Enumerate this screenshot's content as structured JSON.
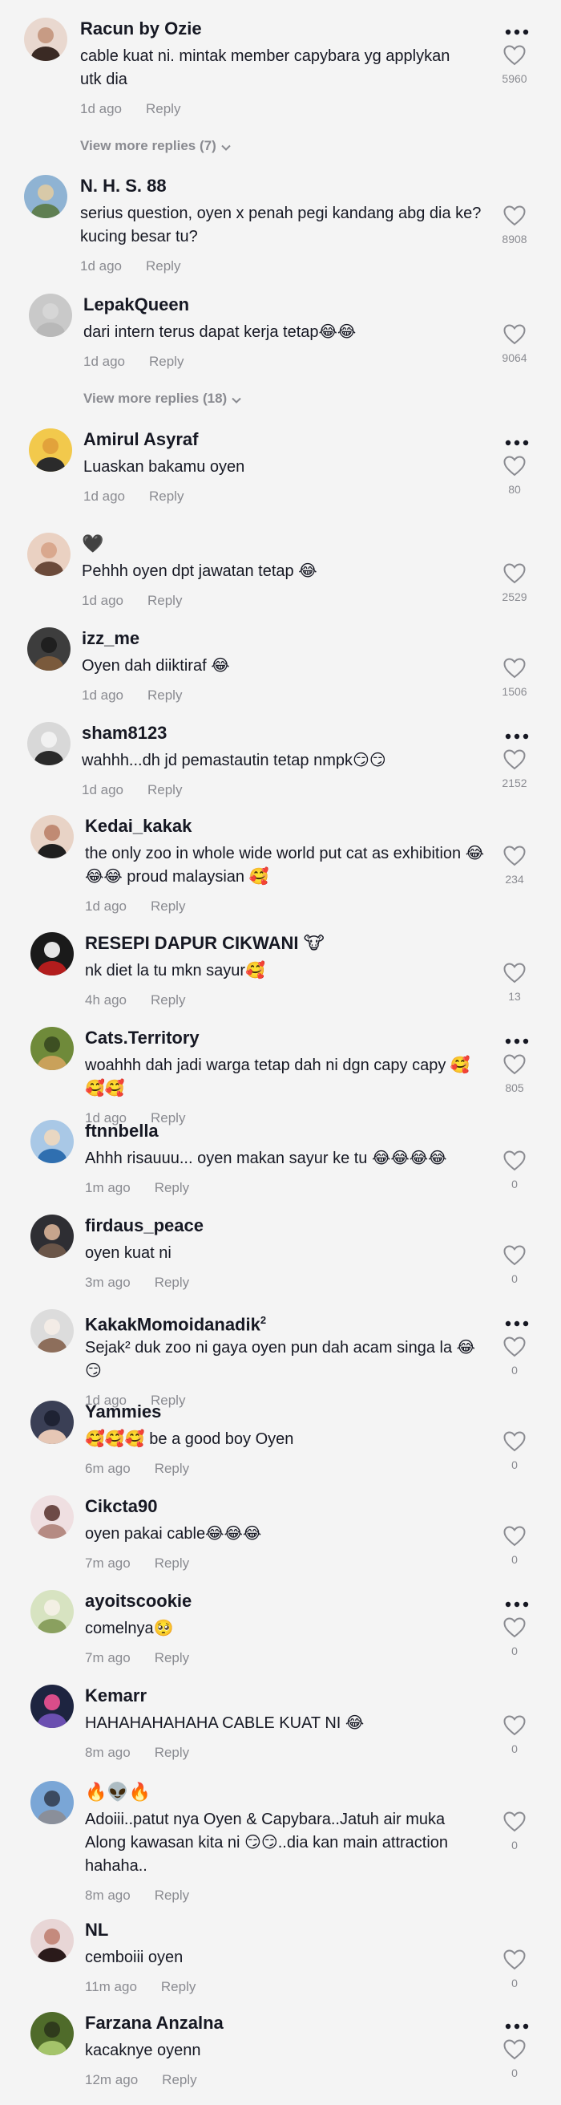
{
  "icons": {
    "more": "more-horizontal-icon",
    "like": "heart-outline-icon",
    "expand": "chevron-down-icon"
  },
  "colors": {
    "background": "#f4f4f4",
    "text": "#161823",
    "secondary": "#8a8b91"
  },
  "reply_label": "Reply",
  "comments": [
    {
      "username": "Racun by Ozie",
      "text": "cable kuat ni. mintak member capybara yg applykan utk dia",
      "time": "1d ago",
      "likes": "5960",
      "more": true,
      "view_more": "View more replies (7)"
    },
    {
      "username": "N. H. S. 88",
      "text": "serius question, oyen x penah pegi kandang abg dia ke? kucing besar tu?",
      "time": "1d ago",
      "likes": "8908",
      "more": false
    },
    {
      "username": "LepakQueen",
      "text": "dari intern terus dapat kerja tetap😂😂",
      "time": "1d ago",
      "likes": "9064",
      "more": false,
      "view_more": "View more replies (18)"
    },
    {
      "username": "Amirul Asyraf",
      "text": "Luaskan bakamu oyen",
      "time": "1d ago",
      "likes": "80",
      "more": true
    },
    {
      "username": "🖤",
      "text": "Pehhh oyen dpt jawatan tetap 😂",
      "time": "1d ago",
      "likes": "2529",
      "more": false
    },
    {
      "username": "izz_me",
      "text": "Oyen dah diiktiraf 😂",
      "time": "1d ago",
      "likes": "1506",
      "more": false
    },
    {
      "username": "sham8123",
      "text": "wahhh...dh jd pemastautin tetap nmpk😏😏",
      "time": "1d ago",
      "likes": "2152",
      "more": true
    },
    {
      "username": "Kedai_kakak",
      "text": "the only zoo in whole wide world put cat as exhibition 😂😂😂 proud malaysian 🥰",
      "time": "1d ago",
      "likes": "234",
      "more": false
    },
    {
      "username": "RESEPI DAPUR CIKWANI 🐮",
      "text": "nk diet la tu mkn sayur🥰",
      "time": "4h ago",
      "likes": "13",
      "more": false
    },
    {
      "username": "Cats.Territory",
      "text": "woahhh dah jadi warga tetap dah ni dgn capy capy 🥰🥰🥰",
      "time": "1d ago",
      "likes": "805",
      "more": true
    },
    {
      "username": "ftnnbella",
      "text": "Ahhh risauuu... oyen makan sayur ke tu 😂😂😂😂",
      "time": "1m ago",
      "likes": "0",
      "more": false
    },
    {
      "username": "firdaus_peace",
      "text": "oyen kuat ni",
      "time": "3m ago",
      "likes": "0",
      "more": false
    },
    {
      "username": "KakakMomoidanadik",
      "username_sup": "2",
      "text": "Sejak² duk zoo ni gaya oyen pun dah acam singa la 😂😏",
      "time": "1d ago",
      "likes": "0",
      "more": true
    },
    {
      "username": "Yammies",
      "text": "🥰🥰🥰 be a good boy Oyen",
      "time": "6m ago",
      "likes": "0",
      "more": false
    },
    {
      "username": "Cikcta90",
      "text": "oyen pakai cable😂😂😂",
      "time": "7m ago",
      "likes": "0",
      "more": false
    },
    {
      "username": "ayoitscookie",
      "text": "comelnya🥺",
      "time": "7m ago",
      "likes": "0",
      "more": true
    },
    {
      "username": "Kemarr",
      "text": "HAHAHAHAHAHA CABLE KUAT NI 😂",
      "time": "8m ago",
      "likes": "0",
      "more": false
    },
    {
      "username": "🔥👽🔥",
      "text": "Adoiii..patut nya Oyen & Capybara..Jatuh air muka Along kawasan kita ni 😏😏..dia kan main attraction hahaha..",
      "time": "8m ago",
      "likes": "0",
      "more": false
    },
    {
      "username": "NL",
      "text": "cemboiii oyen",
      "time": "11m ago",
      "likes": "0",
      "more": false
    },
    {
      "username": "Farzana Anzalna",
      "text": "kacaknye oyenn",
      "time": "12m ago",
      "likes": "0",
      "more": true
    }
  ]
}
